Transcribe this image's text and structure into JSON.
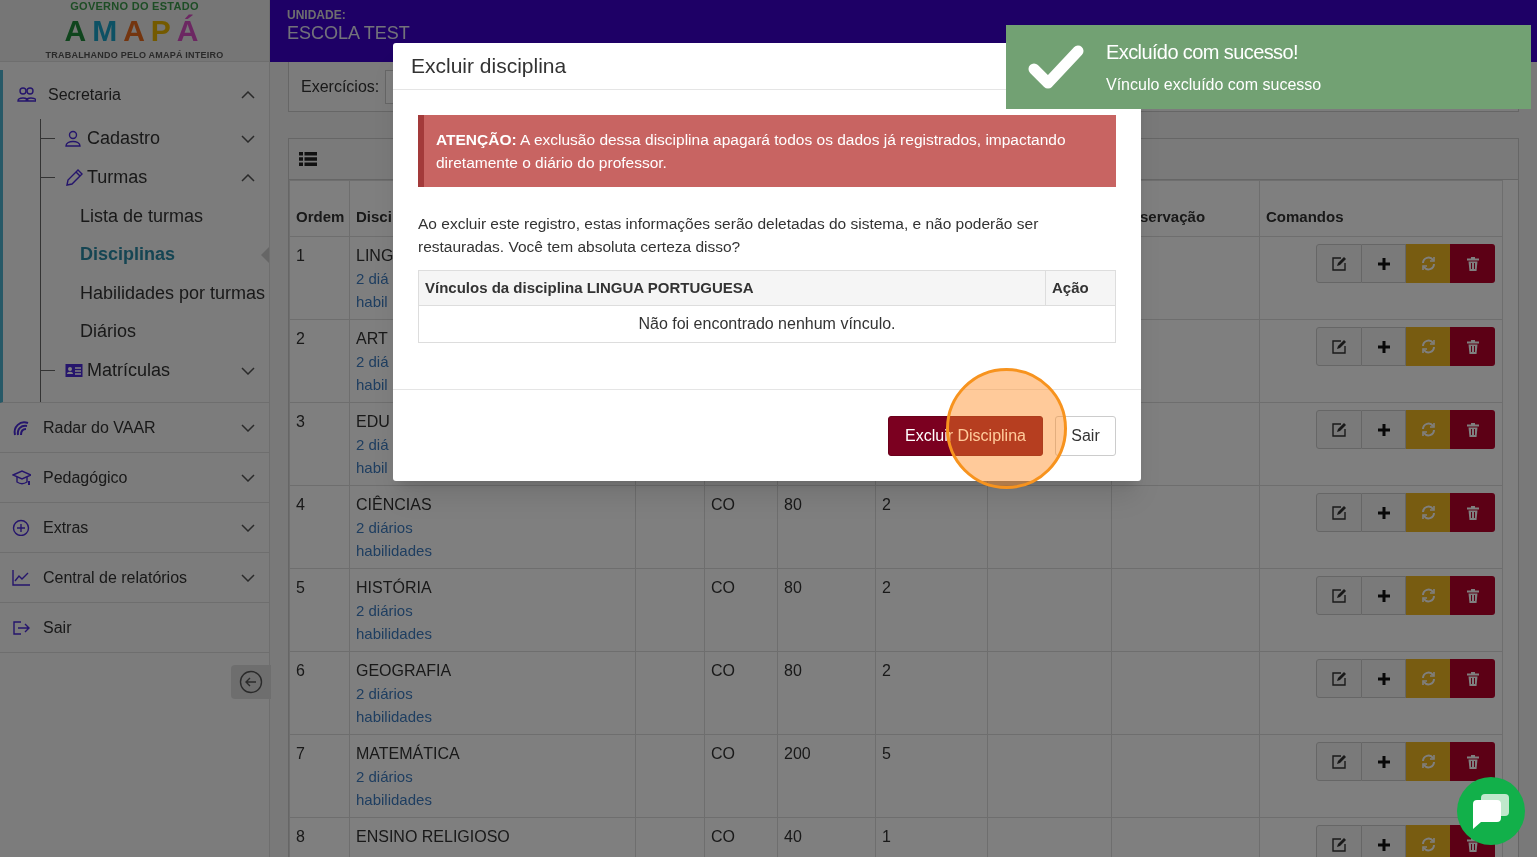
{
  "logo": {
    "top": "GOVERNO DO ESTADO",
    "word": "AMAPÁ",
    "tagline": "TRABALHANDO PELO AMAPÁ INTEIRO"
  },
  "header": {
    "unit_label": "UNIDADE:",
    "unit_name": "ESCOLA TEST"
  },
  "sidebar": {
    "items": [
      {
        "label": "Secretaria",
        "expanded": true,
        "children": [
          {
            "label": "Cadastro",
            "expanded": false
          },
          {
            "label": "Turmas",
            "expanded": true,
            "children": [
              {
                "label": "Lista de turmas",
                "selected": false
              },
              {
                "label": "Disciplinas",
                "selected": true
              },
              {
                "label": "Habilidades por turmas",
                "selected": false
              },
              {
                "label": "Diários",
                "selected": false
              }
            ]
          },
          {
            "label": "Matrículas",
            "expanded": false
          }
        ]
      },
      {
        "label": "Radar do VAAR",
        "expanded": false
      },
      {
        "label": "Pedagógico",
        "expanded": false
      },
      {
        "label": "Extras",
        "expanded": false
      },
      {
        "label": "Central de relatórios",
        "expanded": false
      },
      {
        "label": "Sair"
      }
    ]
  },
  "filter": {
    "label": "Exercícios:"
  },
  "table": {
    "columns": {
      "order": "Ordem",
      "discipline": "Disci",
      "observation": "servação",
      "commands": "Comandos"
    },
    "rows": [
      {
        "order": "1",
        "name": "LING",
        "diaries": "2 diá",
        "skills": "habil"
      },
      {
        "order": "2",
        "name": "ART",
        "diaries": "2 diá",
        "skills": "habil"
      },
      {
        "order": "3",
        "name": "EDU",
        "diaries": "2 diá",
        "skills": "habil"
      },
      {
        "order": "4",
        "name": "CIÊNCIAS",
        "diaries": "2 diários",
        "skills": "habilidades",
        "cells": [
          "CO",
          "80",
          "2"
        ]
      },
      {
        "order": "5",
        "name": "HISTÓRIA",
        "diaries": "2 diários",
        "skills": "habilidades",
        "cells": [
          "CO",
          "80",
          "2"
        ]
      },
      {
        "order": "6",
        "name": "GEOGRAFIA",
        "diaries": "2 diários",
        "skills": "habilidades",
        "cells": [
          "CO",
          "80",
          "2"
        ]
      },
      {
        "order": "7",
        "name": "MATEMÁTICA",
        "diaries": "2 diários",
        "skills": "habilidades",
        "cells": [
          "CO",
          "200",
          "5"
        ]
      },
      {
        "order": "8",
        "name": "ENSINO RELIGIOSO",
        "cells": [
          "CO",
          "40",
          "1"
        ]
      }
    ]
  },
  "modal": {
    "title": "Excluir disciplina",
    "alert": "**ATENÇÃO:** A exclusão dessa disciplina apagará todos os dados já registrados, impactando diretamente o diário do professor.",
    "message": "Ao excluir este registro, estas informações serão deletadas do sistema, e não poderão ser restauradas. Você tem absoluta certeza disso?",
    "links_table": {
      "columns": [
        "Vínculos da disciplina LINGUA PORTUGUESA",
        "Ação"
      ],
      "empty_text": "Não foi encontrado nenhum vínculo."
    },
    "buttons": [
      {
        "label": "Excluir Disciplina",
        "kind": "danger"
      },
      {
        "label": "Sair",
        "kind": "default"
      }
    ]
  },
  "toast": {
    "title": "Excluído com sucesso!",
    "message": "Vínculo excluído com sucesso"
  }
}
